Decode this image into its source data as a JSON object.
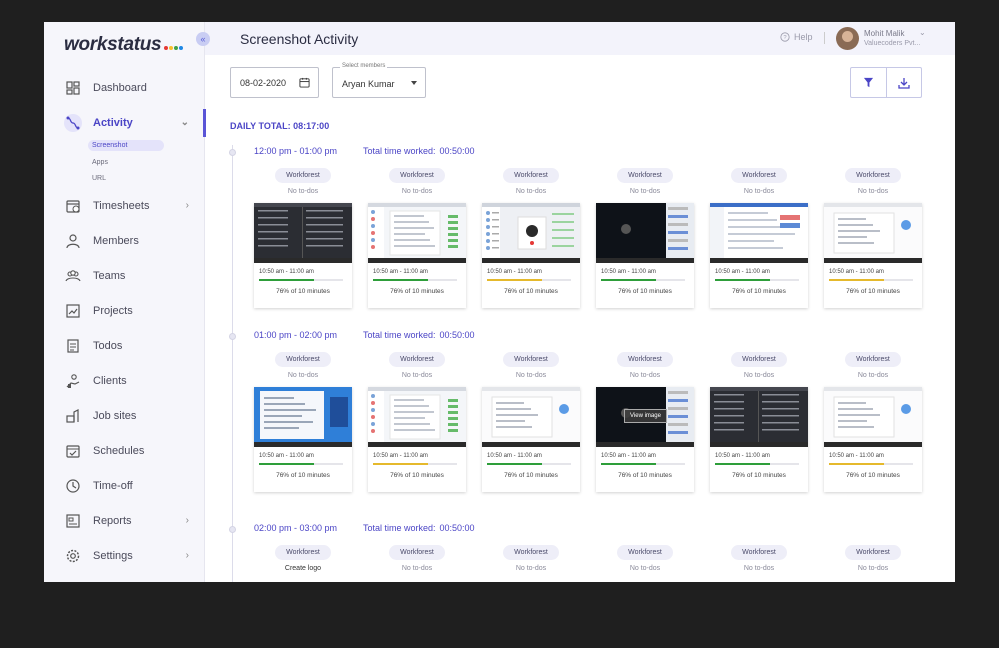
{
  "app": {
    "logo": "workstatus",
    "logo_dot_colors": [
      "#e53935",
      "#fbc02d",
      "#43a047",
      "#1e88e5"
    ],
    "page_title": "Screenshot Activity",
    "help": "Help",
    "user_name": "Mohit Malik",
    "user_company": "Valuecoders Pvt...",
    "accent": "#4b45c6"
  },
  "sidebar": {
    "items": [
      {
        "label": "Dashboard",
        "icon": "dashboard-icon",
        "chev": ""
      },
      {
        "label": "Activity",
        "icon": "activity-icon",
        "chev": "⌄",
        "active": true
      },
      {
        "label": "Timesheets",
        "icon": "timesheets-icon",
        "chev": "›"
      },
      {
        "label": "Members",
        "icon": "member-icon",
        "chev": ""
      },
      {
        "label": "Teams",
        "icon": "teams-icon",
        "chev": ""
      },
      {
        "label": "Projects",
        "icon": "projects-icon",
        "chev": ""
      },
      {
        "label": "Todos",
        "icon": "todos-icon",
        "chev": ""
      },
      {
        "label": "Clients",
        "icon": "clients-icon",
        "chev": ""
      },
      {
        "label": "Job sites",
        "icon": "jobsites-icon",
        "chev": ""
      },
      {
        "label": "Schedules",
        "icon": "schedules-icon",
        "chev": ""
      },
      {
        "label": "Time-off",
        "icon": "timeoff-icon",
        "chev": ""
      },
      {
        "label": "Reports",
        "icon": "reports-icon",
        "chev": "›"
      },
      {
        "label": "Settings",
        "icon": "settings-icon",
        "chev": "›"
      }
    ],
    "sub_items": [
      "Screenshot",
      "Apps",
      "URL"
    ]
  },
  "controls": {
    "date": "08-02-2020",
    "member_legend": "Select members",
    "member_value": "Aryan Kumar"
  },
  "daily_total": "DAILY TOTAL: 08:17:00",
  "sections": [
    {
      "range": "12:00 pm - 01:00 pm",
      "total_label": "Total time worked:",
      "total_value": "00:50:00",
      "cards": [
        {
          "tag": "Workforest",
          "todo": "No to-dos",
          "time": "10:50 am - 11:00 am",
          "pct": "76% of 10 minutes",
          "progress": 0.65,
          "bar": "#2e9e3a",
          "theme": "dark"
        },
        {
          "tag": "Workforest",
          "todo": "No to-dos",
          "time": "10:50 am - 11:00 am",
          "pct": "76% of 10 minutes",
          "progress": 0.65,
          "bar": "#2e9e3a",
          "theme": "light"
        },
        {
          "tag": "Workforest",
          "todo": "No to-dos",
          "time": "10:50 am - 11:00 am",
          "pct": "76% of 10 minutes",
          "progress": 0.65,
          "bar": "#e5b92c",
          "theme": "call"
        },
        {
          "tag": "Workforest",
          "todo": "No to-dos",
          "time": "10:50 am - 11:00 am",
          "pct": "76% of 10 minutes",
          "progress": 0.65,
          "bar": "#2e9e3a",
          "theme": "video"
        },
        {
          "tag": "Workforest",
          "todo": "No to-dos",
          "time": "10:50 am - 11:00 am",
          "pct": "76% of 10 minutes",
          "progress": 0.65,
          "bar": "#2e9e3a",
          "theme": "blue"
        },
        {
          "tag": "Workforest",
          "todo": "No to-dos",
          "time": "10:50 am - 11:00 am",
          "pct": "76% of 10 minutes",
          "progress": 0.65,
          "bar": "#e5b92c",
          "theme": "white"
        }
      ]
    },
    {
      "range": "01:00 pm - 02:00 pm",
      "total_label": "Total time worked:",
      "total_value": "00:50:00",
      "cards": [
        {
          "tag": "Workforest",
          "todo": "No to-dos",
          "time": "10:50 am - 11:00 am",
          "pct": "76% of 10 minutes",
          "progress": 0.65,
          "bar": "#2e9e3a",
          "theme": "bluewin"
        },
        {
          "tag": "Workforest",
          "todo": "No to-dos",
          "time": "10:50 am - 11:00 am",
          "pct": "76% of 10 minutes",
          "progress": 0.65,
          "bar": "#e5b92c",
          "theme": "light"
        },
        {
          "tag": "Workforest",
          "todo": "No to-dos",
          "time": "10:50 am - 11:00 am",
          "pct": "76% of 10 minutes",
          "progress": 0.65,
          "bar": "#2e9e3a",
          "theme": "white"
        },
        {
          "tag": "Workforest",
          "todo": "No to-dos",
          "time": "10:50 am - 11:00 am",
          "pct": "76% of 10 minutes",
          "progress": 0.65,
          "bar": "#2e9e3a",
          "theme": "video",
          "overlay": "View image"
        },
        {
          "tag": "Workforest",
          "todo": "No to-dos",
          "time": "10:50 am - 11:00 am",
          "pct": "76% of 10 minutes",
          "progress": 0.65,
          "bar": "#2e9e3a",
          "theme": "dark"
        },
        {
          "tag": "Workforest",
          "todo": "No to-dos",
          "time": "10:50 am - 11:00 am",
          "pct": "76% of 10 minutes",
          "progress": 0.65,
          "bar": "#e5b92c",
          "theme": "white"
        }
      ]
    },
    {
      "range": "02:00 pm - 03:00 pm",
      "total_label": "Total time worked:",
      "total_value": "00:50:00",
      "cards": [
        {
          "tag": "Workforest",
          "todo": "Create logo",
          "dark": true
        },
        {
          "tag": "Workforest",
          "todo": "No to-dos"
        },
        {
          "tag": "Workforest",
          "todo": "No to-dos"
        },
        {
          "tag": "Workforest",
          "todo": "No to-dos"
        },
        {
          "tag": "Workforest",
          "todo": "No to-dos"
        },
        {
          "tag": "Workforest",
          "todo": "No to-dos"
        }
      ]
    }
  ]
}
